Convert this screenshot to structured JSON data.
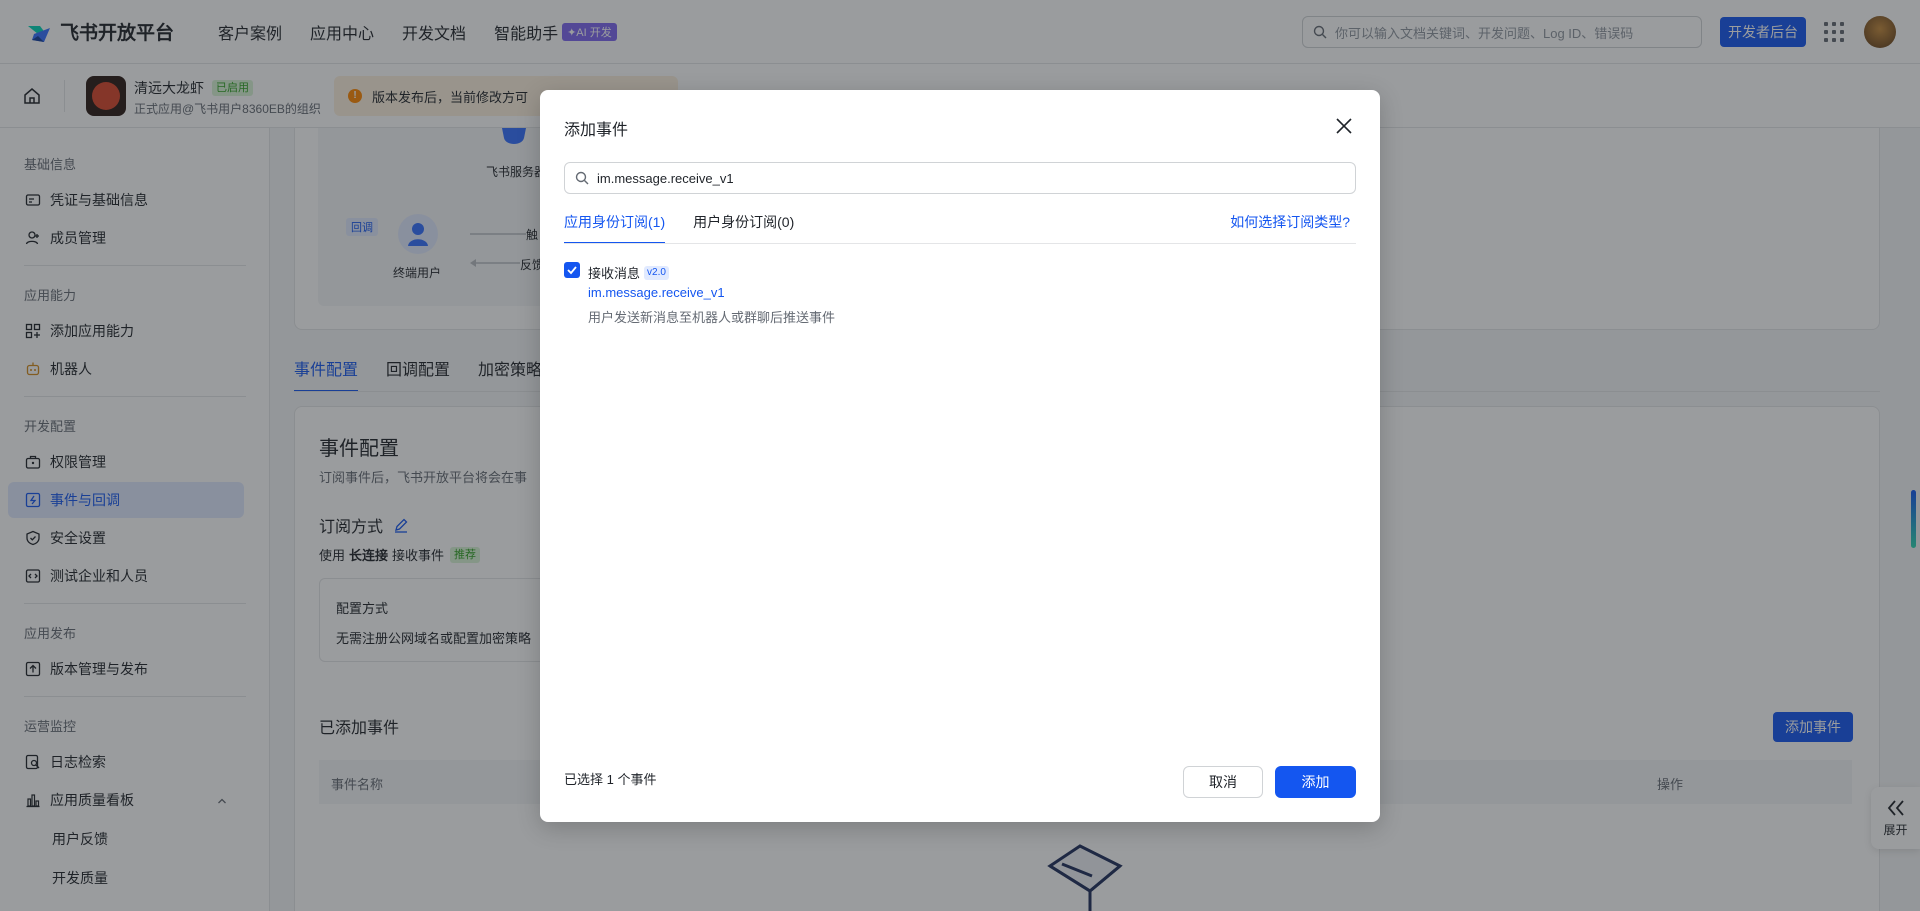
{
  "topnav": {
    "logo_text": "飞书开放平台",
    "links": [
      "客户案例",
      "应用中心",
      "开发文档",
      "智能助手"
    ],
    "ai_badge": "✦AI 开发",
    "search_placeholder": "你可以输入文档关键词、开发问题、Log ID、错误码",
    "dev_console": "开发者后台"
  },
  "apphead": {
    "app_name": "清远大龙虾",
    "status": "已启用",
    "app_sub": "正式应用@飞书用户8360EB的组织",
    "notice": "版本发布后，当前修改方可"
  },
  "sidebar": {
    "groups": [
      "基础信息",
      "应用能力",
      "开发配置",
      "应用发布",
      "运营监控"
    ],
    "items": [
      "凭证与基础信息",
      "成员管理",
      "添加应用能力",
      "机器人",
      "权限管理",
      "事件与回调",
      "安全设置",
      "测试企业和人员",
      "版本管理与发布",
      "日志检索",
      "应用质量看板"
    ],
    "sub_items": [
      "用户反馈",
      "开发质量"
    ]
  },
  "flow": {
    "server": "飞书服务器",
    "tag": "回调",
    "user": "终端用户",
    "line1": "触",
    "line2": "反馈"
  },
  "main": {
    "tabs": [
      "事件配置",
      "回调配置",
      "加密策略"
    ],
    "title": "事件配置",
    "desc": "订阅事件后，飞书开放平台将会在事",
    "sub_title": "订阅方式",
    "use_prefix": "使用",
    "use_bold": "长连接",
    "use_suffix": "接收事件",
    "recommend": "推荐",
    "cfg_title": "配置方式",
    "cfg_desc": "无需注册公网域名或配置加密策略",
    "added_title": "已添加事件",
    "add_event": "添加事件",
    "th_name": "事件名称",
    "th_op": "操作",
    "expand": "展开"
  },
  "modal": {
    "title": "添加事件",
    "search_value": "im.message.receive_v1",
    "tabs": [
      "应用身份订阅(1)",
      "用户身份订阅(0)"
    ],
    "help_link": "如何选择订阅类型?",
    "event": {
      "name": "接收消息",
      "version": "v2.0",
      "key": "im.message.receive_v1",
      "desc": "用户发送新消息至机器人或群聊后推送事件"
    },
    "selected_text": "已选择 1 个事件",
    "cancel": "取消",
    "add": "添加"
  },
  "colors": {
    "primary": "#1456f0",
    "overlay": "rgba(31,35,41,0.45)",
    "success": "#2ea121"
  }
}
